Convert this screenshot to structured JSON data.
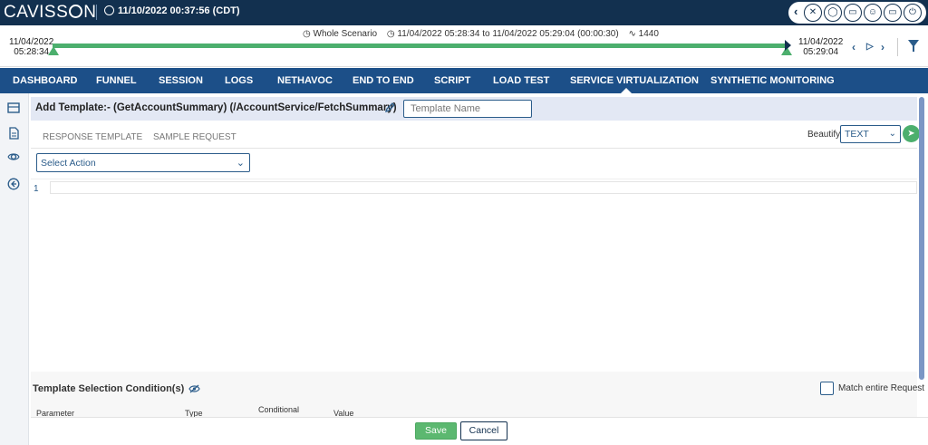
{
  "app": {
    "logo_prefix": "CAVISS",
    "logo_suffix": "N",
    "server_time": "11/10/2022 00:37:56 (CDT)"
  },
  "header_icons": [
    "collapse-arrow-icon",
    "tools-icon",
    "bell-icon",
    "monitor-icon",
    "user-icon",
    "display-icon",
    "power-icon"
  ],
  "timeline": {
    "scenario": "Whole Scenario",
    "range": "11/04/2022 05:28:34 to 11/04/2022 05:29:04 (00:00:30)",
    "count": "1440",
    "start_date": "11/04/2022",
    "start_time": "05:28:34",
    "end_date": "11/04/2022",
    "end_time": "05:29:04"
  },
  "nav": {
    "items": [
      "DASHBOARD",
      "FUNNEL",
      "SESSION",
      "LOGS",
      "NETHAVOC",
      "END TO END",
      "SCRIPT",
      "LOAD TEST",
      "SERVICE VIRTUALIZATION",
      "SYNTHETIC MONITORING"
    ],
    "active": "SERVICE VIRTUALIZATION"
  },
  "main": {
    "title": "Add Template:- (GetAccountSummary) (/AccountService/FetchSummary)",
    "template_name_placeholder": "Template Name",
    "tabs": [
      "RESPONSE TEMPLATE",
      "SAMPLE REQUEST"
    ],
    "beautify_label": "Beautify",
    "beautify_value": "TEXT",
    "select_action": "Select Action",
    "editor_line": "1"
  },
  "conditions": {
    "title": "Template Selection Condition(s)",
    "match_label": "Match entire Request",
    "columns": [
      "Parameter",
      "Type",
      "Conditional",
      "Value"
    ]
  },
  "footer": {
    "save": "Save",
    "cancel": "Cancel"
  }
}
